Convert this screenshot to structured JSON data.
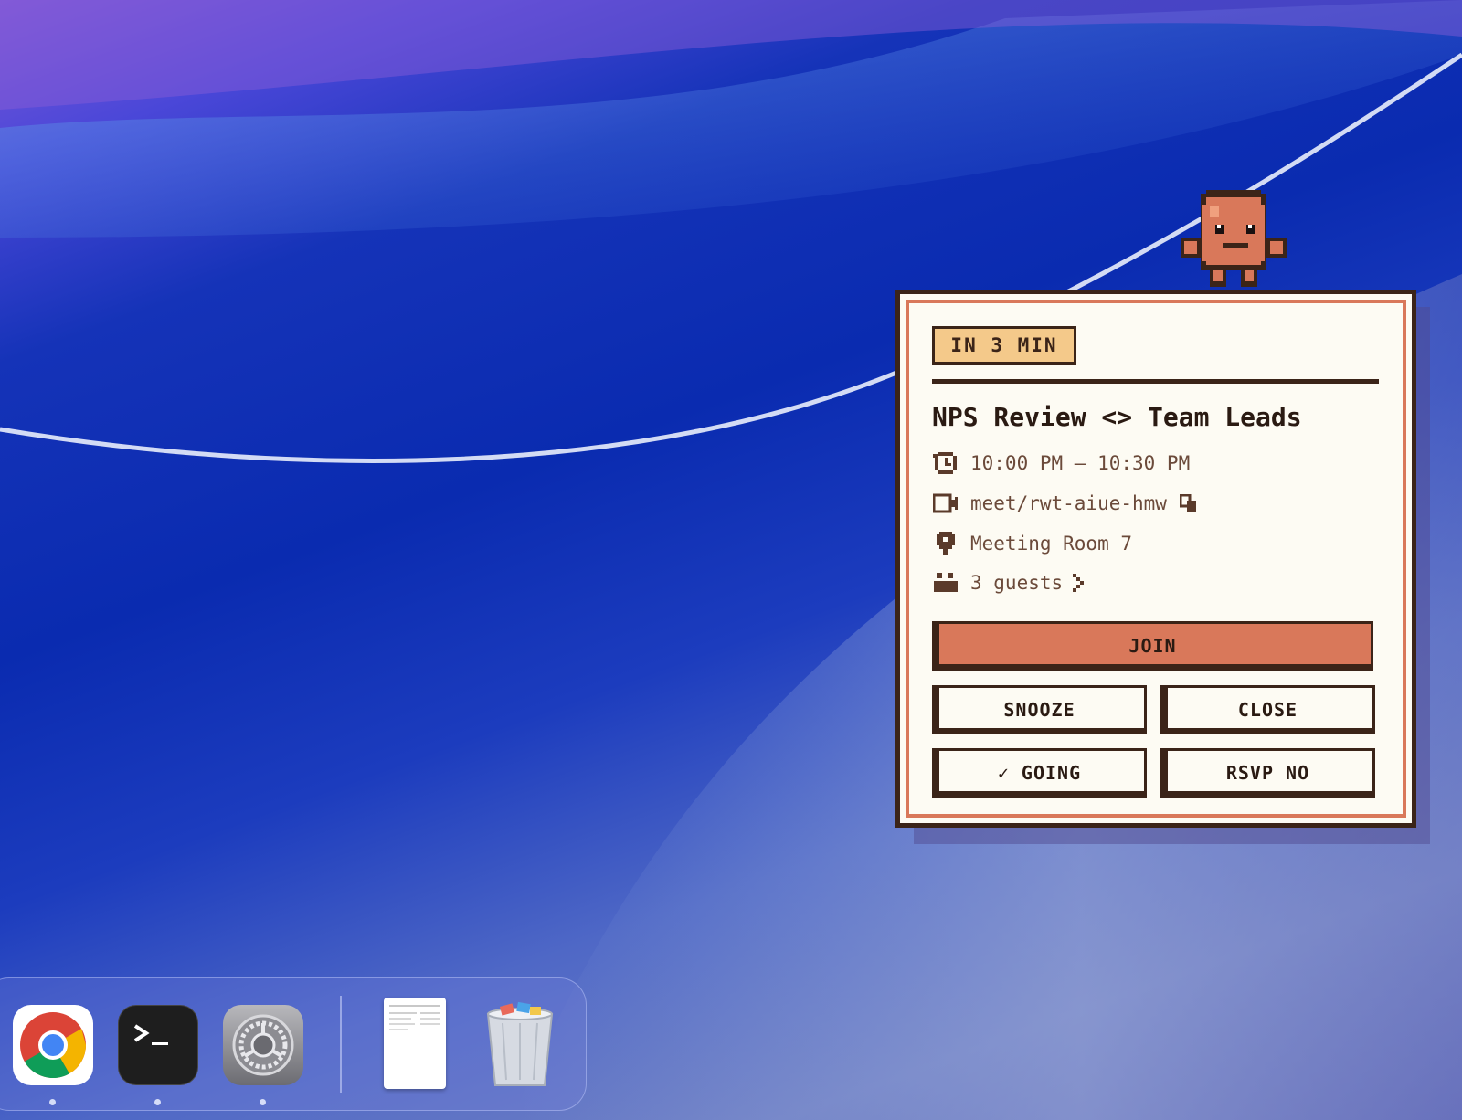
{
  "notification": {
    "countdown_badge": "IN 3 MIN",
    "title": "NPS Review <> Team Leads",
    "time": "10:00 PM — 10:30 PM",
    "meet_link": "meet/rwt-aiue-hmw",
    "location": "Meeting Room 7",
    "guests": "3 guests",
    "join_label": "JOIN",
    "snooze_label": "SNOOZE",
    "close_label": "CLOSE",
    "going_label": "✓ GOING",
    "rsvp_no_label": "RSVP NO"
  },
  "dock": {
    "apps": [
      {
        "name": "Chrome",
        "icon": "chrome-icon",
        "running": true
      },
      {
        "name": "Terminal",
        "icon": "terminal-icon",
        "running": true
      },
      {
        "name": "System Settings",
        "icon": "settings-gear-icon",
        "running": true
      },
      {
        "name": "Document",
        "icon": "document-icon",
        "running": false
      },
      {
        "name": "Trash",
        "icon": "trash-icon",
        "running": false
      }
    ]
  },
  "colors": {
    "card_border": "#3b2418",
    "accent": "#d9785a",
    "badge": "#f4c98a",
    "card_bg": "#fdfbf3"
  }
}
